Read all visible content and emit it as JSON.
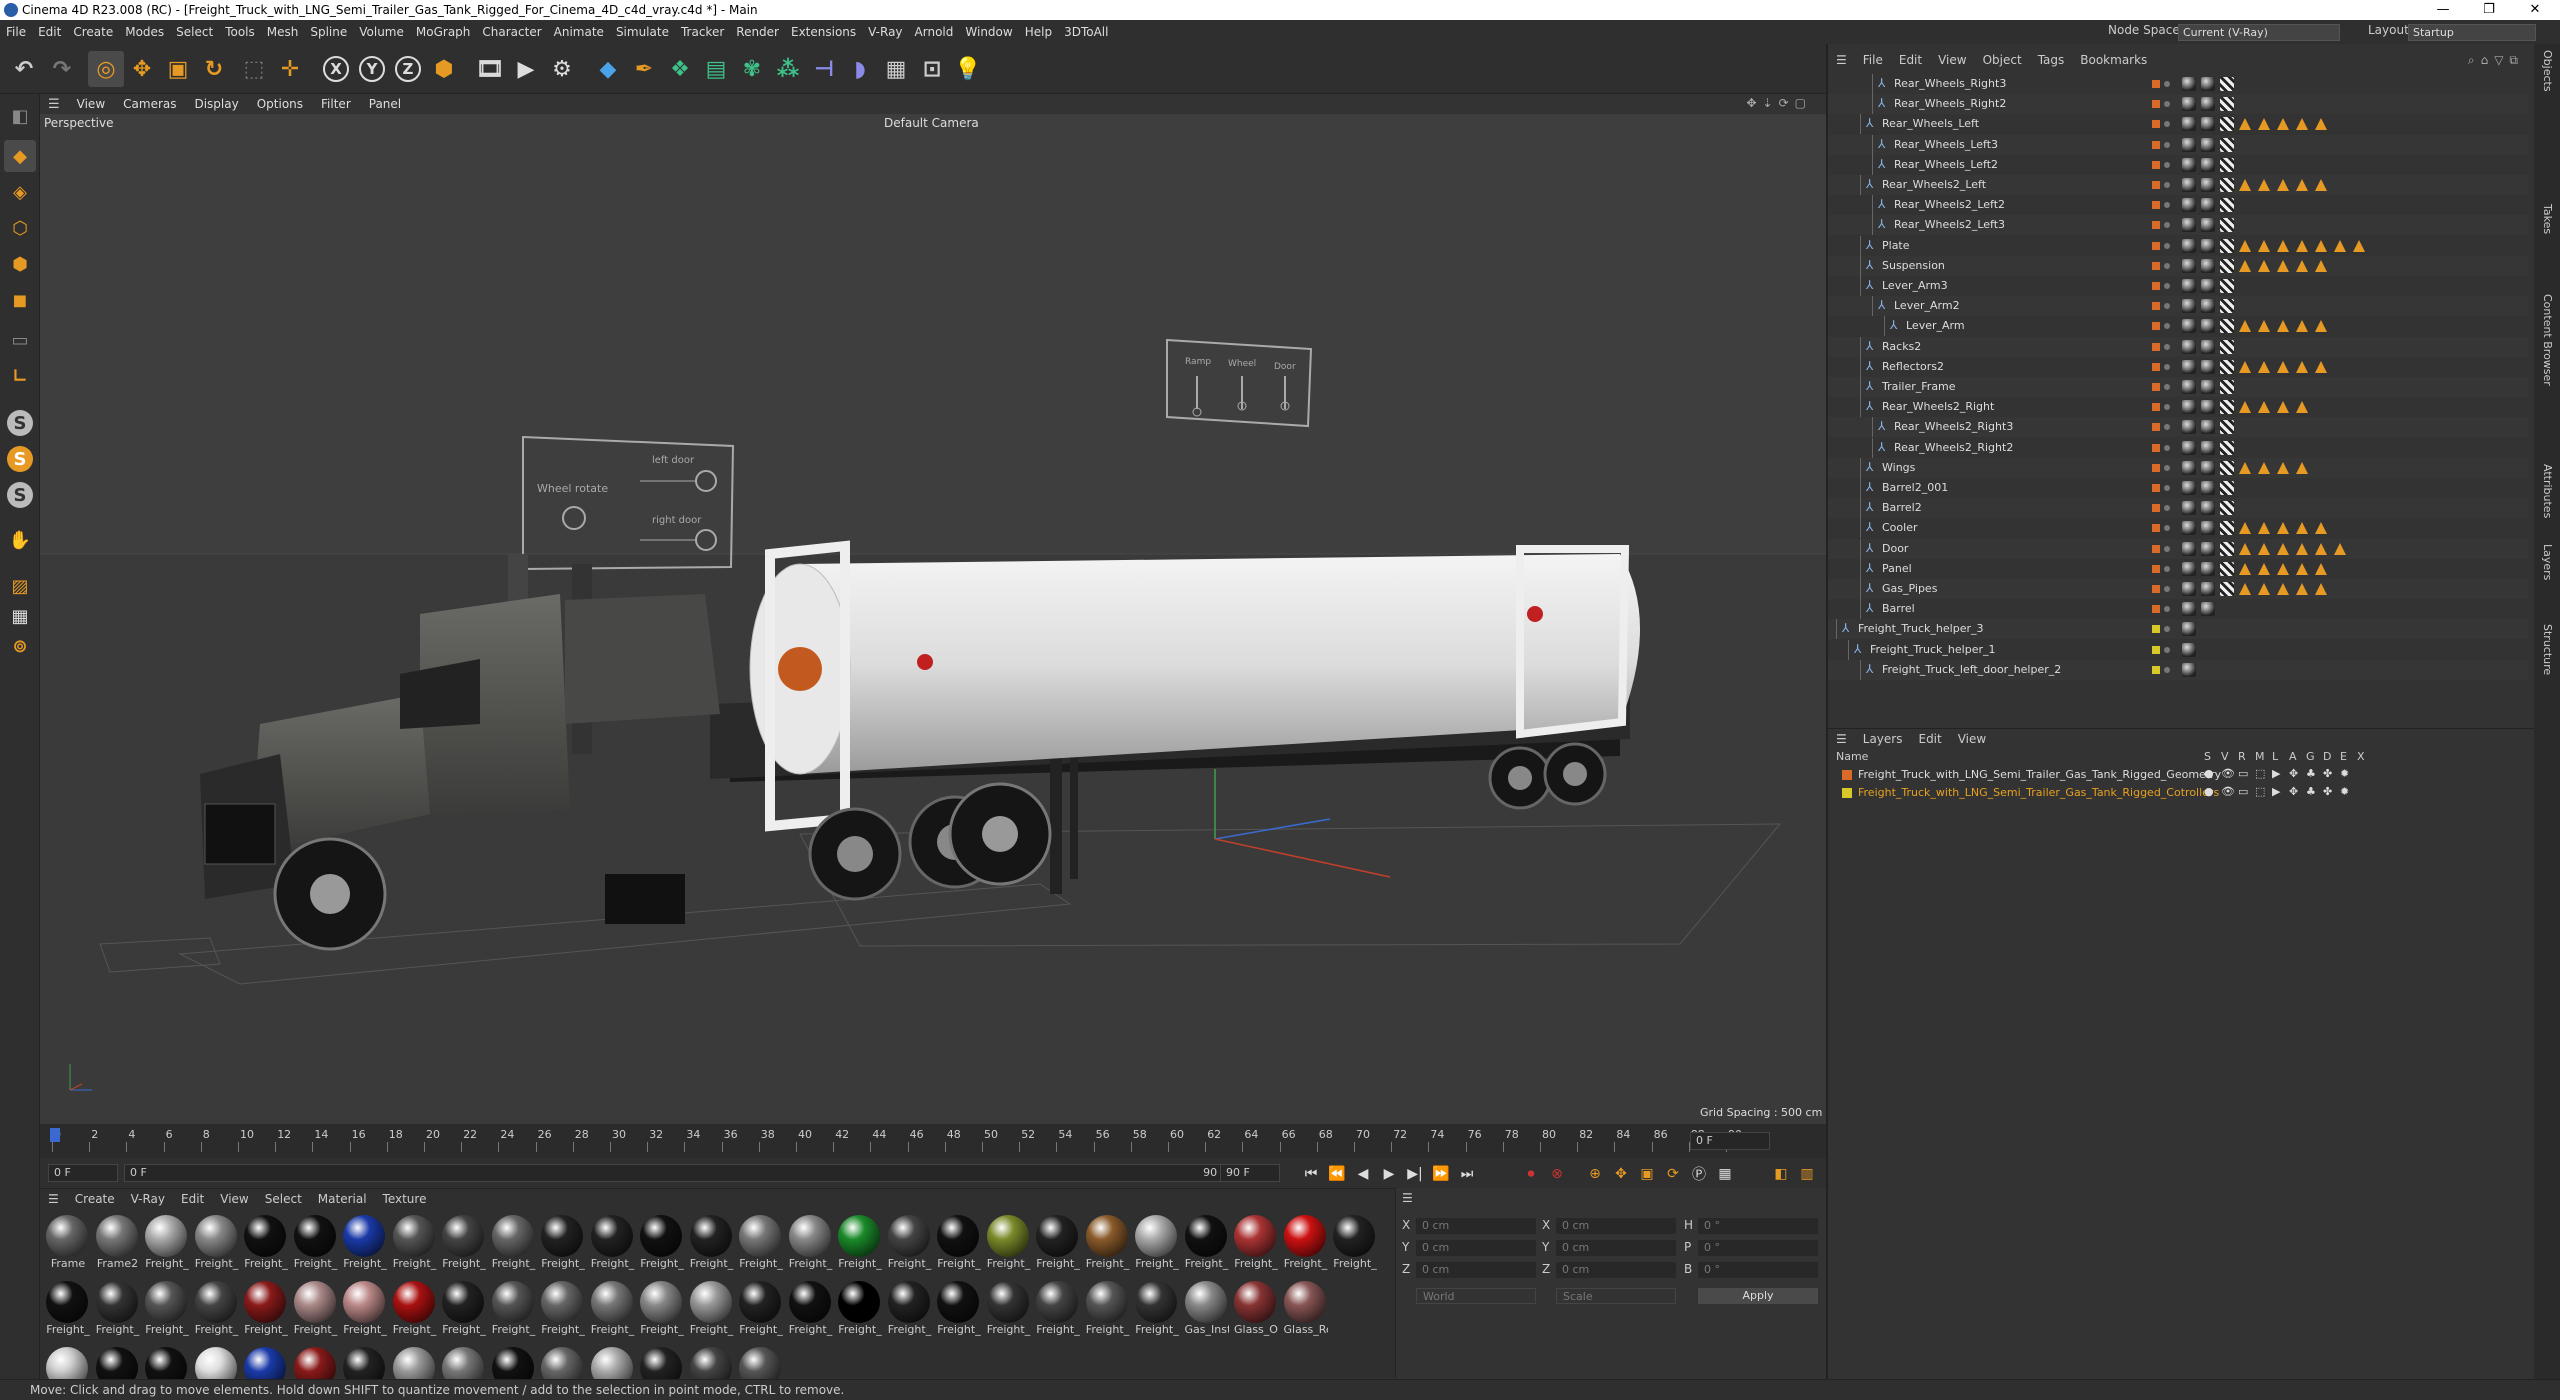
{
  "window": {
    "title": "Cinema 4D R23.008 (RC) - [Freight_Truck_with_LNG_Semi_Trailer_Gas_Tank_Rigged_For_Cinema_4D_c4d_vray.c4d *] - Main",
    "controls": [
      "—",
      "❐",
      "✕"
    ]
  },
  "menubar": {
    "items": [
      "File",
      "Edit",
      "Create",
      "Modes",
      "Select",
      "Tools",
      "Mesh",
      "Spline",
      "Volume",
      "MoGraph",
      "Character",
      "Animate",
      "Simulate",
      "Tracker",
      "Render",
      "Extensions",
      "V-Ray",
      "Arnold",
      "Window",
      "Help",
      "3DToAll"
    ],
    "node_space_label": "Node Space:",
    "node_space_value": "Current (V-Ray)",
    "layout_label": "Layout:",
    "layout_value": "Startup"
  },
  "toolbar": {
    "axis_labels": [
      "X",
      "Y",
      "Z"
    ]
  },
  "viewport": {
    "menu": [
      "View",
      "Cameras",
      "Display",
      "Options",
      "Filter",
      "Panel"
    ],
    "label": "Perspective",
    "camera": "Default Camera",
    "grid_spacing": "Grid Spacing : 500 cm",
    "hud1": {
      "title": "Wheel rotate",
      "left_door": "left door",
      "right_door": "right door"
    },
    "hud2": {
      "labels": [
        "Ramp",
        "Wheel",
        "Door"
      ]
    }
  },
  "timeline": {
    "ticks": [
      "0",
      "2",
      "4",
      "6",
      "8",
      "10",
      "12",
      "14",
      "16",
      "18",
      "20",
      "22",
      "24",
      "26",
      "28",
      "30",
      "32",
      "34",
      "36",
      "38",
      "40",
      "42",
      "44",
      "46",
      "48",
      "50",
      "52",
      "54",
      "56",
      "58",
      "60",
      "62",
      "64",
      "66",
      "68",
      "70",
      "72",
      "74",
      "76",
      "78",
      "80",
      "82",
      "84",
      "86",
      "88",
      "90"
    ],
    "current_frame": "0 F"
  },
  "transport": {
    "start": "0 F",
    "current": "0 F",
    "end": "90 F",
    "end2": "90 F"
  },
  "materials": {
    "menu": [
      "Create",
      "V-Ray",
      "Edit",
      "View",
      "Select",
      "Material",
      "Texture"
    ],
    "row1": [
      {
        "label": "Frame",
        "color": "#666"
      },
      {
        "label": "Frame2",
        "color": "#777"
      },
      {
        "label": "Freight_",
        "color": "#aaa"
      },
      {
        "label": "Freight_",
        "color": "#888"
      },
      {
        "label": "Freight_",
        "color": "#111"
      },
      {
        "label": "Freight_",
        "color": "#111"
      },
      {
        "label": "Freight_",
        "color": "#1a3aa8"
      },
      {
        "label": "Freight_",
        "color": "#555"
      },
      {
        "label": "Freight_",
        "color": "#444"
      },
      {
        "label": "Freight_",
        "color": "#666"
      },
      {
        "label": "Freight_",
        "color": "#222"
      },
      {
        "label": "Freight_",
        "color": "#222"
      },
      {
        "label": "Freight_",
        "color": "#111"
      },
      {
        "label": "Freight_",
        "color": "#222"
      },
      {
        "label": "Freight_",
        "color": "#777"
      },
      {
        "label": "Freight_",
        "color": "#888"
      },
      {
        "label": "Freight_",
        "color": "#1a8a2a"
      },
      {
        "label": "Freight_",
        "color": "#444"
      },
      {
        "label": "Freight_",
        "color": "#111"
      },
      {
        "label": "Freight_",
        "color": "#7a8a2a"
      },
      {
        "label": "Freight_",
        "color": "#222"
      },
      {
        "label": "Freight_",
        "color": "#8a5a2a"
      },
      {
        "label": "Freight_",
        "color": "#aaa"
      },
      {
        "label": "Freight_",
        "color": "#111"
      },
      {
        "label": "Freight_",
        "color": "#a33"
      },
      {
        "label": "Freight_",
        "color": "#c11"
      },
      {
        "label": "Freight_",
        "color": "#222"
      }
    ],
    "row2": [
      {
        "label": "Freight_",
        "color": "#111"
      },
      {
        "label": "Freight_",
        "color": "#333"
      },
      {
        "label": "Freight_",
        "color": "#555"
      },
      {
        "label": "Freight_",
        "color": "#444"
      },
      {
        "label": "Freight_",
        "color": "#8a1a1a"
      },
      {
        "label": "Freight_",
        "color": "#a88"
      },
      {
        "label": "Freight_",
        "color": "#b88"
      },
      {
        "label": "Freight_",
        "color": "#a11"
      },
      {
        "label": "Freight_",
        "color": "#222"
      },
      {
        "label": "Freight_",
        "color": "#555"
      },
      {
        "label": "Freight_",
        "color": "#666"
      },
      {
        "label": "Freight_",
        "color": "#777"
      },
      {
        "label": "Freight_",
        "color": "#888"
      },
      {
        "label": "Freight_",
        "color": "#999"
      },
      {
        "label": "Freight_",
        "color": "#222"
      },
      {
        "label": "Freight_",
        "color": "#111"
      },
      {
        "label": "Freight_",
        "color": "#000"
      },
      {
        "label": "Freight_",
        "color": "#222"
      },
      {
        "label": "Freight_",
        "color": "#111"
      },
      {
        "label": "Freight_",
        "color": "#333"
      },
      {
        "label": "Freight_",
        "color": "#444"
      },
      {
        "label": "Freight_",
        "color": "#555"
      },
      {
        "label": "Freight_",
        "color": "#333"
      },
      {
        "label": "Gas_Inst",
        "color": "#888"
      },
      {
        "label": "Glass_Or",
        "color": "#833"
      },
      {
        "label": "Glass_Re",
        "color": "#855"
      }
    ],
    "row3": [
      {
        "color": "#ccc"
      },
      {
        "color": "#111"
      },
      {
        "color": "#111"
      },
      {
        "color": "#ddd"
      },
      {
        "color": "#1a3aa8"
      },
      {
        "color": "#8a1a1a"
      },
      {
        "color": "#222"
      },
      {
        "color": "#999"
      },
      {
        "color": "#777"
      },
      {
        "color": "#111"
      },
      {
        "color": "#666"
      },
      {
        "color": "#aaa"
      },
      {
        "color": "#222"
      },
      {
        "color": "#444"
      },
      {
        "color": "#555"
      }
    ]
  },
  "attributes": {
    "x": "X",
    "y": "Y",
    "z": "Z",
    "x2": "X",
    "y2": "Y",
    "z2": "Z",
    "h": "H",
    "p": "P",
    "b": "B",
    "pos": [
      "0 cm",
      "0 cm",
      "0 cm"
    ],
    "size": [
      "0 cm",
      "0 cm",
      "0 cm"
    ],
    "rot": [
      "0 °",
      "0 °",
      "0 °"
    ],
    "world": "World",
    "scale": "Scale",
    "apply": "Apply"
  },
  "status": "Move: Click and drag to move elements. Hold down SHIFT to quantize movement / add to the selection in point mode, CTRL to remove.",
  "objects": {
    "menu": [
      "File",
      "Edit",
      "View",
      "Object",
      "Tags",
      "Bookmarks"
    ],
    "rows": [
      {
        "name": "Rear_Wheels_Right3",
        "indent": 3,
        "tags": 3,
        "dot": "#d96a28"
      },
      {
        "name": "Rear_Wheels_Right2",
        "indent": 3,
        "tags": 3,
        "dot": "#d96a28"
      },
      {
        "name": "Rear_Wheels_Left",
        "indent": 2,
        "tags": 8,
        "dot": "#d96a28"
      },
      {
        "name": "Rear_Wheels_Left3",
        "indent": 3,
        "tags": 3,
        "dot": "#d96a28"
      },
      {
        "name": "Rear_Wheels_Left2",
        "indent": 3,
        "tags": 3,
        "dot": "#d96a28"
      },
      {
        "name": "Rear_Wheels2_Left",
        "indent": 2,
        "tags": 8,
        "dot": "#d96a28"
      },
      {
        "name": "Rear_Wheels2_Left2",
        "indent": 3,
        "tags": 3,
        "dot": "#d96a28"
      },
      {
        "name": "Rear_Wheels2_Left3",
        "indent": 3,
        "tags": 3,
        "dot": "#d96a28"
      },
      {
        "name": "Plate",
        "indent": 2,
        "tags": 10,
        "dot": "#d96a28"
      },
      {
        "name": "Suspension",
        "indent": 2,
        "tags": 8,
        "dot": "#d96a28"
      },
      {
        "name": "Lever_Arm3",
        "indent": 2,
        "tags": 3,
        "dot": "#d96a28"
      },
      {
        "name": "Lever_Arm2",
        "indent": 3,
        "tags": 3,
        "dot": "#d96a28"
      },
      {
        "name": "Lever_Arm",
        "indent": 4,
        "tags": 8,
        "dot": "#d96a28"
      },
      {
        "name": "Racks2",
        "indent": 2,
        "tags": 3,
        "dot": "#d96a28"
      },
      {
        "name": "Reflectors2",
        "indent": 2,
        "tags": 8,
        "dot": "#d96a28"
      },
      {
        "name": "Trailer_Frame",
        "indent": 2,
        "tags": 3,
        "dot": "#d96a28"
      },
      {
        "name": "Rear_Wheels2_Right",
        "indent": 2,
        "tags": 7,
        "dot": "#d96a28"
      },
      {
        "name": "Rear_Wheels2_Right3",
        "indent": 3,
        "tags": 3,
        "dot": "#d96a28"
      },
      {
        "name": "Rear_Wheels2_Right2",
        "indent": 3,
        "tags": 3,
        "dot": "#d96a28"
      },
      {
        "name": "Wings",
        "indent": 2,
        "tags": 7,
        "dot": "#d96a28"
      },
      {
        "name": "Barrel2_001",
        "indent": 2,
        "tags": 3,
        "dot": "#d96a28"
      },
      {
        "name": "Barrel2",
        "indent": 2,
        "tags": 3,
        "dot": "#d96a28"
      },
      {
        "name": "Cooler",
        "indent": 2,
        "tags": 8,
        "dot": "#d96a28"
      },
      {
        "name": "Door",
        "indent": 2,
        "tags": 9,
        "dot": "#d96a28"
      },
      {
        "name": "Panel",
        "indent": 2,
        "tags": 8,
        "dot": "#d96a28"
      },
      {
        "name": "Gas_Pipes",
        "indent": 2,
        "tags": 8,
        "dot": "#d96a28"
      },
      {
        "name": "Barrel",
        "indent": 2,
        "tags": 2,
        "dot": "#d96a28"
      },
      {
        "name": "Freight_Truck_helper_3",
        "indent": 0,
        "tags": 1,
        "dot": "#d8c828"
      },
      {
        "name": "Freight_Truck_helper_1",
        "indent": 1,
        "tags": 1,
        "dot": "#d8c828"
      },
      {
        "name": "Freight_Truck_left_door_helper_2",
        "indent": 2,
        "tags": 1,
        "dot": "#d8c828"
      }
    ]
  },
  "layers": {
    "menu": [
      "Layers",
      "Edit",
      "View"
    ],
    "col_name": "Name",
    "cols": [
      "S",
      "V",
      "R",
      "M",
      "L",
      "A",
      "G",
      "D",
      "E",
      "X"
    ],
    "rows": [
      {
        "name": "Freight_Truck_with_LNG_Semi_Trailer_Gas_Tank_Rigged_Geometry",
        "color": "#d96a28",
        "text": "#ddd"
      },
      {
        "name": "Freight_Truck_with_LNG_Semi_Trailer_Gas_Tank_Rigged_Cotrollers",
        "color": "#d8c828",
        "text": "#e8a020"
      }
    ]
  },
  "side_tabs": [
    "Objects",
    "Takes",
    "Content Browser",
    "Attributes",
    "Layers",
    "Structure"
  ]
}
